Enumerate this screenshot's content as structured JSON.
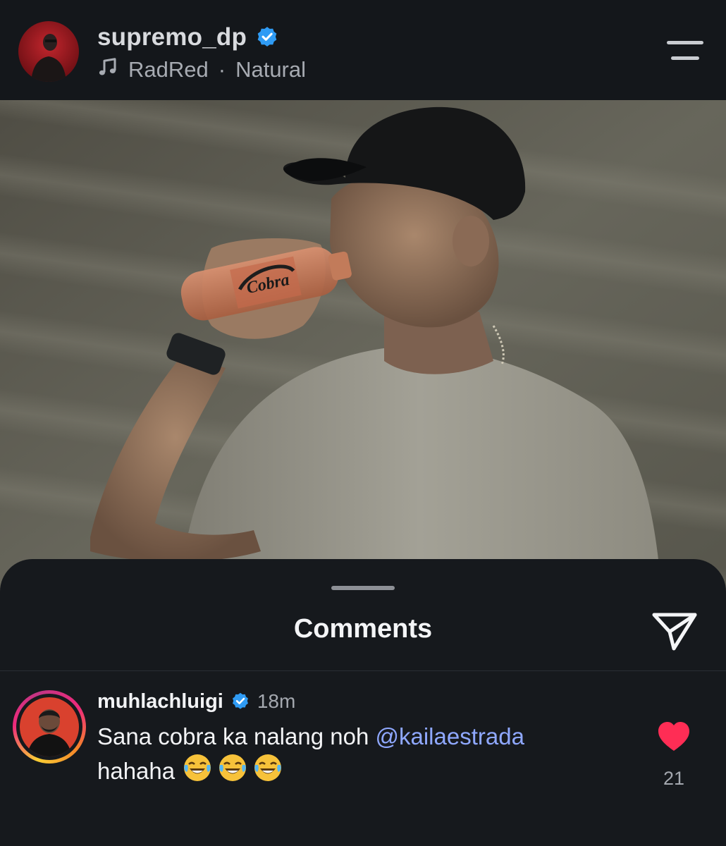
{
  "header": {
    "username": "supremo_dp",
    "music_artist": "RadRed",
    "music_separator": "·",
    "music_track": "Natural"
  },
  "post": {
    "bottle_label": "Cobra"
  },
  "comments_sheet": {
    "title": "Comments",
    "comments": [
      {
        "username": "muhlachluigi",
        "time": "18m",
        "text_before": "Sana cobra ka nalang noh ",
        "mention": "@kailaestrada",
        "text_after": "hahaha",
        "like_count": "21",
        "emojis": [
          "face-with-tears-of-joy",
          "face-with-tears-of-joy",
          "face-with-tears-of-joy"
        ]
      }
    ]
  },
  "colors": {
    "verified_blue": "#2f9bf4",
    "mention_blue": "#8fa8ff",
    "like_red": "#ff2d55",
    "background": "#16191d"
  },
  "icons": {
    "verified": "verified-badge-icon",
    "music": "music-note-icon",
    "menu": "hamburger-menu-icon",
    "share": "send-paper-plane-icon",
    "like": "heart-icon"
  }
}
